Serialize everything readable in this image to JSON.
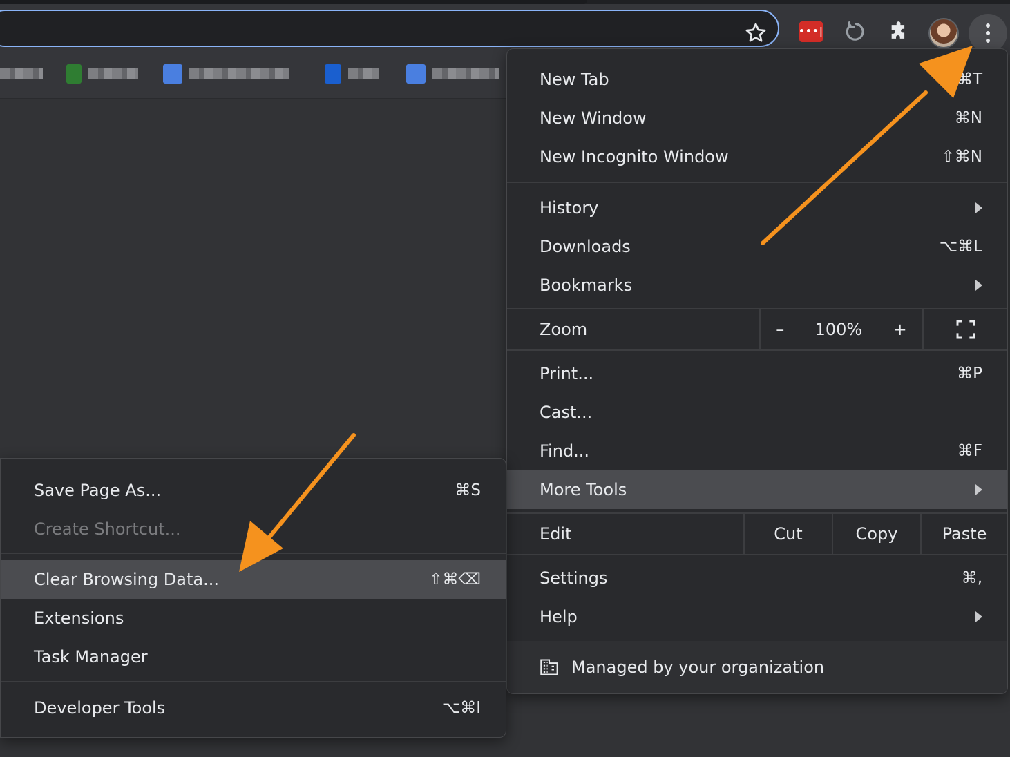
{
  "colors": {
    "accent": "#8ab4f8",
    "arrow": "#f5921e",
    "menu_bg": "#292a2d",
    "highlight": "#4b4c50"
  },
  "toolbar": {
    "star_icon": "star-outline-icon",
    "extensions": [
      {
        "name": "lastpass-icon",
        "text": "•••|"
      },
      {
        "name": "refresh-extension-icon"
      },
      {
        "name": "puzzle-icon"
      }
    ],
    "avatar": "profile-avatar",
    "menu_icon": "three-dots-vertical-icon"
  },
  "main_menu": {
    "items": [
      {
        "label": "New Tab",
        "shortcut": "⌘T"
      },
      {
        "label": "New Window",
        "shortcut": "⌘N"
      },
      {
        "label": "New Incognito Window",
        "shortcut": "⇧⌘N"
      },
      {
        "label": "History",
        "shortcut": ""
      },
      {
        "label": "Downloads",
        "shortcut": "⌥⌘L"
      },
      {
        "label": "Bookmarks",
        "shortcut": ""
      },
      {
        "label": "Print...",
        "shortcut": "⌘P"
      },
      {
        "label": "Cast...",
        "shortcut": ""
      },
      {
        "label": "Find...",
        "shortcut": "⌘F"
      },
      {
        "label": "More Tools",
        "shortcut": ""
      },
      {
        "label": "Settings",
        "shortcut": "⌘,"
      },
      {
        "label": "Help",
        "shortcut": ""
      }
    ],
    "zoom": {
      "label": "Zoom",
      "minus": "–",
      "value": "100%",
      "plus": "+"
    },
    "edit": {
      "label": "Edit",
      "cut": "Cut",
      "copy": "Copy",
      "paste": "Paste"
    },
    "managed": "Managed by your organization"
  },
  "more_tools_menu": {
    "items": [
      {
        "label": "Save Page As...",
        "shortcut": "⌘S"
      },
      {
        "label": "Create Shortcut...",
        "shortcut": ""
      },
      {
        "label": "Clear Browsing Data...",
        "shortcut": "⇧⌘⌫"
      },
      {
        "label": "Extensions",
        "shortcut": ""
      },
      {
        "label": "Task Manager",
        "shortcut": ""
      },
      {
        "label": "Developer Tools",
        "shortcut": "⌥⌘I"
      }
    ]
  }
}
